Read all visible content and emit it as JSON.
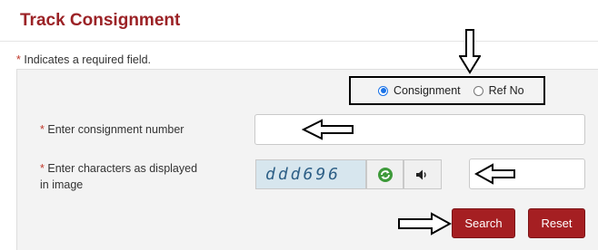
{
  "page": {
    "title": "Track Consignment",
    "required_note": "Indicates a required field.",
    "required_marker": "*"
  },
  "search_type": {
    "options": [
      "Consignment",
      "Ref No"
    ],
    "selected": "Consignment"
  },
  "form": {
    "consignment_label": "Enter consignment number",
    "consignment_value": "",
    "captcha_label_line1": "Enter characters as displayed",
    "captcha_label_line2": "in image",
    "captcha_text": "ddd696",
    "captcha_answer": ""
  },
  "buttons": {
    "search": "Search",
    "reset": "Reset"
  },
  "colors": {
    "title": "#9b2226",
    "button": "#a51f22",
    "radio_selected": "#1a73e8"
  },
  "icons": [
    "refresh-icon",
    "speaker-icon",
    "arrow-down-icon",
    "arrow-left-icon",
    "arrow-right-icon"
  ]
}
